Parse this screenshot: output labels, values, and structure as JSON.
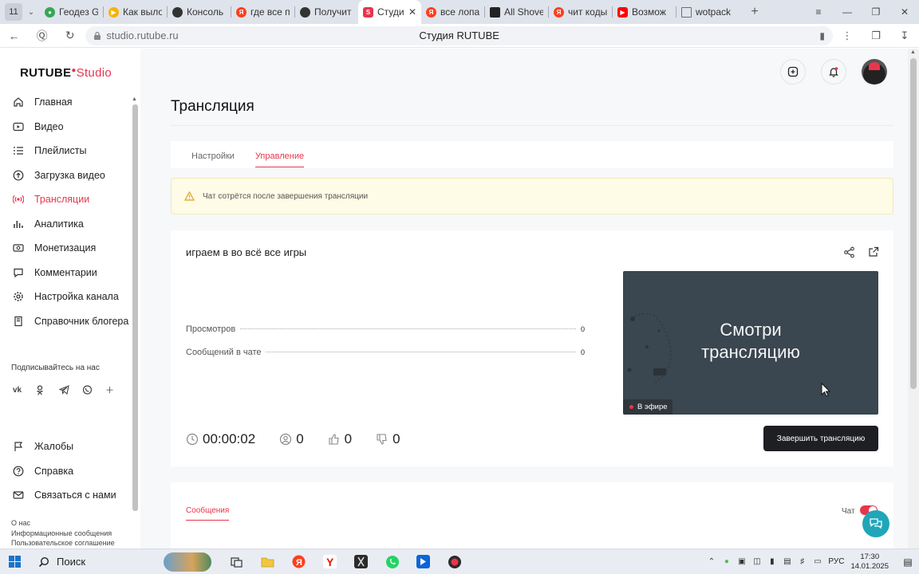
{
  "browser": {
    "tab_counter": "11",
    "tabs": [
      {
        "label": "Геодез G",
        "icon": "maps-pin-icon",
        "color": "#34a853"
      },
      {
        "label": "Как выло",
        "icon": "play-icon",
        "color": "#f4b400"
      },
      {
        "label": "Консоль",
        "icon": "console-icon",
        "color": "#333333"
      },
      {
        "label": "где все п",
        "icon": "yandex-icon",
        "color": "#fc3f1d"
      },
      {
        "label": "Получит",
        "icon": "shield-icon",
        "color": "#333333"
      },
      {
        "label": "Студи",
        "icon": "rutube-icon",
        "color": "#e8354c",
        "active": true
      },
      {
        "label": "все лопа",
        "icon": "yandex-icon",
        "color": "#fc3f1d"
      },
      {
        "label": "All Shove",
        "icon": "app-icon",
        "color": "#222222"
      },
      {
        "label": "чит коды",
        "icon": "yandex-icon",
        "color": "#fc3f1d"
      },
      {
        "label": "Возмож",
        "icon": "youtube-icon",
        "color": "#ff0000"
      },
      {
        "label": "wotpack",
        "icon": "page-icon",
        "color": "#6b6f76"
      }
    ],
    "url": "studio.rutube.ru",
    "page_title": "Студия RUTUBE"
  },
  "logo": {
    "brand": "RUTUBE",
    "product": "Studio"
  },
  "sidebar": {
    "items": [
      {
        "label": "Главная",
        "icon": "home-icon"
      },
      {
        "label": "Видео",
        "icon": "video-icon"
      },
      {
        "label": "Плейлисты",
        "icon": "playlist-icon"
      },
      {
        "label": "Загрузка видео",
        "icon": "upload-icon"
      },
      {
        "label": "Трансляции",
        "icon": "broadcast-icon",
        "active": true
      },
      {
        "label": "Аналитика",
        "icon": "analytics-icon"
      },
      {
        "label": "Монетизация",
        "icon": "monetization-icon"
      },
      {
        "label": "Комментарии",
        "icon": "comments-icon"
      },
      {
        "label": "Настройка канала",
        "icon": "settings-icon"
      },
      {
        "label": "Справочник блогера",
        "icon": "handbook-icon"
      }
    ],
    "subscribe_label": "Подписывайтесь на нас",
    "socials": [
      "vk-icon",
      "ok-icon",
      "telegram-icon",
      "viber-icon",
      "plus-icon"
    ],
    "secondary_items": [
      {
        "label": "Жалобы",
        "icon": "flag-icon"
      },
      {
        "label": "Справка",
        "icon": "help-icon"
      },
      {
        "label": "Связаться с нами",
        "icon": "mail-icon"
      }
    ],
    "footer_links": [
      "О нас",
      "Информационные сообщения",
      "Пользовательское соглашение"
    ]
  },
  "page": {
    "title": "Трансляция",
    "tabs": [
      {
        "label": "Настройки"
      },
      {
        "label": "Управление",
        "active": true
      }
    ],
    "notice": "Чат сотрётся после завершения трансляции"
  },
  "stream": {
    "name": "играем в во всё все игры",
    "stats": [
      {
        "label": "Просмотров",
        "value": "0"
      },
      {
        "label": "Сообщений в чате",
        "value": "0"
      }
    ],
    "preview_line1": "Смотри",
    "preview_line2": "трансляцию",
    "live_label": "В эфире",
    "timer": "00:00:02",
    "viewers": "0",
    "likes": "0",
    "dislikes": "0",
    "end_button": "Завершить трансляцию"
  },
  "chat": {
    "messages_tab": "Сообщения",
    "chat_toggle_label": "Чат",
    "chat_enabled": true
  },
  "taskbar": {
    "search_label": "Поиск",
    "lang": "РУС",
    "time": "17:30",
    "date": "14.01.2025"
  },
  "colors": {
    "accent": "#e8354c",
    "notice_bg": "#fefbe6",
    "end_button_bg": "#1d1f22",
    "support": "#1fa6b8"
  }
}
